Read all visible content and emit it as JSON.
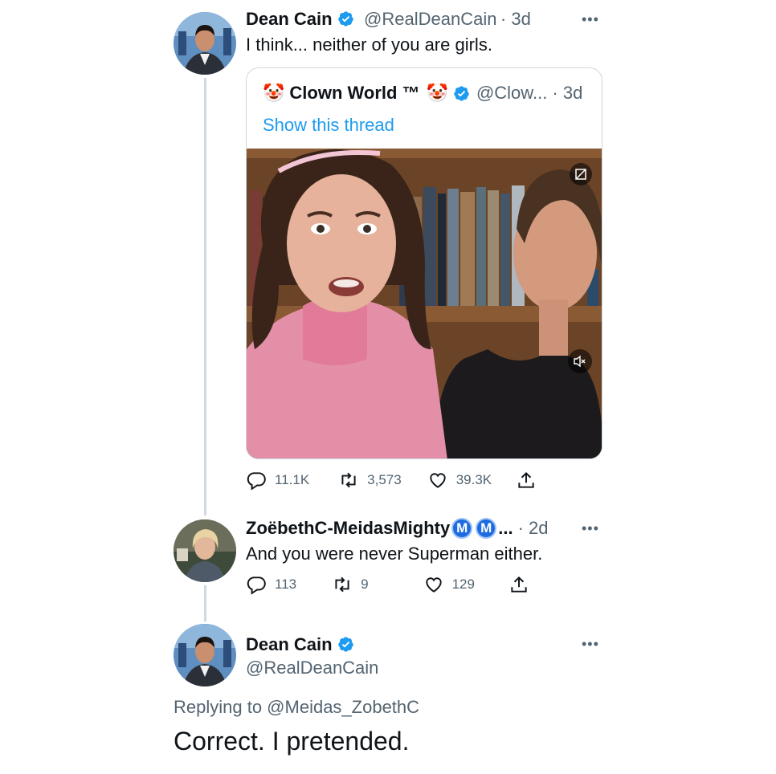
{
  "tweet1": {
    "name": "Dean Cain",
    "handle": "@RealDeanCain",
    "time": "· 3d",
    "text": "I think... neither of you are girls.",
    "more": "•••"
  },
  "quote": {
    "emoji_left": "🤡",
    "name": "Clown World ™",
    "emoji_right": "🤡",
    "handle": "@Clow... · 3d",
    "show_thread": "Show this thread"
  },
  "tweet1_actions": {
    "replies": "11.1K",
    "retweets": "3,573",
    "likes": "39.3K"
  },
  "tweet2": {
    "name": "ZoëbethC-MeidasMighty",
    "badge_1": "M",
    "badge_2": "M",
    "ellipsis": "...",
    "time": "· 2d",
    "text": "And you were never Superman either.",
    "more": "•••"
  },
  "tweet2_actions": {
    "replies": "113",
    "retweets": "9",
    "likes": "129"
  },
  "tweet3": {
    "name": "Dean Cain",
    "handle": "@RealDeanCain",
    "replying_to": "Replying to @Meidas_ZobethC",
    "text": "Correct. I pretended.",
    "more": "•••"
  },
  "colors": {
    "verified": "#1d9bf0",
    "link": "#1d9bf0",
    "muted": "#536471"
  },
  "icons": [
    "reply-icon",
    "retweet-icon",
    "like-icon",
    "share-icon",
    "verified-icon",
    "mute-icon",
    "sensitive-icon"
  ]
}
